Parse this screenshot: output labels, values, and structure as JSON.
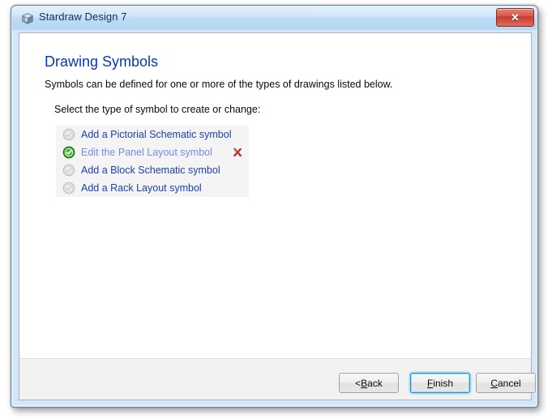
{
  "window": {
    "title": "Stardraw Design 7",
    "app_icon": "cube-icon",
    "close_label": "✕"
  },
  "page": {
    "title": "Drawing Symbols",
    "subtitle": "Symbols can be defined for one or more of the types of drawings listed below.",
    "prompt": "Select the type of symbol to create or change:"
  },
  "options": [
    {
      "label": "Add a Pictorial Schematic symbol",
      "icon": "check-circle-gray-icon",
      "selected": false,
      "has_delete": false
    },
    {
      "label": "Edit the Panel Layout symbol",
      "icon": "check-circle-green-icon",
      "selected": true,
      "has_delete": true
    },
    {
      "label": "Add a Block Schematic symbol",
      "icon": "check-circle-gray-icon",
      "selected": false,
      "has_delete": false
    },
    {
      "label": "Add a Rack Layout symbol",
      "icon": "check-circle-gray-icon",
      "selected": false,
      "has_delete": false
    }
  ],
  "footer": {
    "back": {
      "prefix": "< ",
      "accel": "B",
      "rest": "ack"
    },
    "finish": {
      "accel": "F",
      "rest": "inish"
    },
    "cancel": {
      "accel": "C",
      "rest": "ancel"
    }
  },
  "colors": {
    "title_blue": "#0836bb",
    "link_blue": "#1b3fb0",
    "selected_blue": "#6f8fe0",
    "row_bg": "#f4f4f4",
    "titlebar_blue": "#b4d7f3",
    "close_red": "#c33c31",
    "check_green": "#2ca11f",
    "delete_red": "#c0392b",
    "focus_cyan": "#2e92c8"
  }
}
